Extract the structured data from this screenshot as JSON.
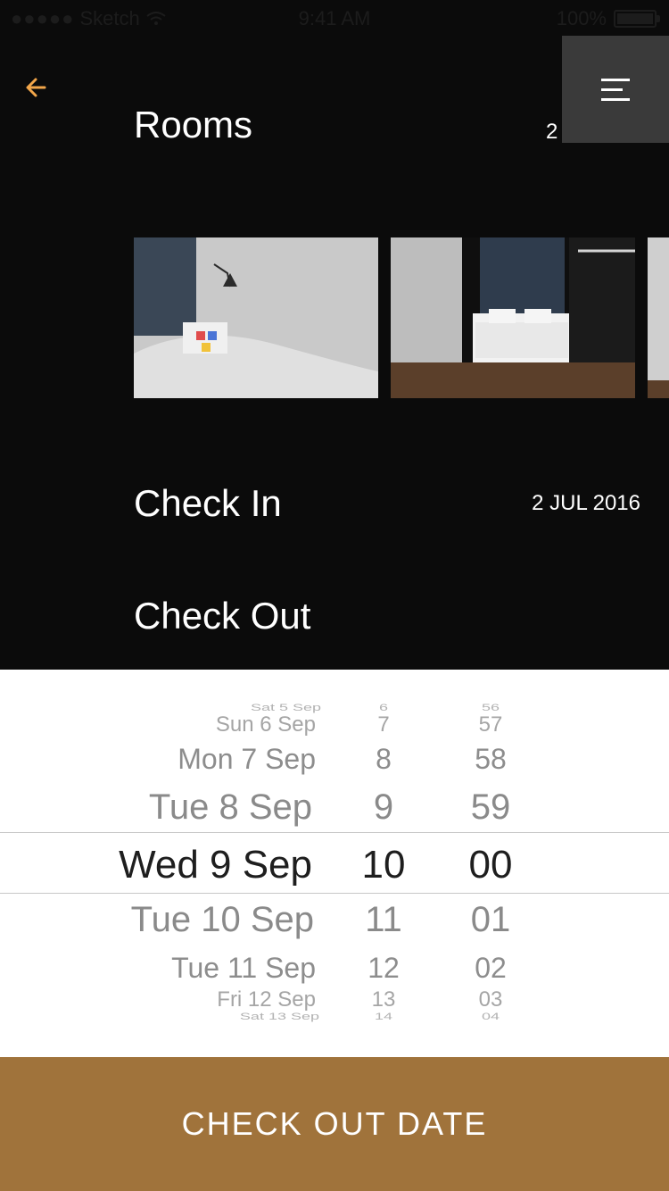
{
  "status_bar": {
    "carrier": "Sketch",
    "time": "9:41 AM",
    "battery": "100%"
  },
  "header": {
    "rooms_title": "Rooms",
    "rooms_count": "2"
  },
  "booking": {
    "check_in_label": "Check In",
    "check_in_date": "2 JUL 2016",
    "check_out_label": "Check Out"
  },
  "picker": {
    "dates": [
      "Sat 5 Sep",
      "Sun 6 Sep",
      "Mon 7 Sep",
      "Tue 8 Sep",
      "Wed 9 Sep",
      "Tue 10 Sep",
      "Tue 11 Sep",
      "Fri 12 Sep",
      "Sat 13 Sep"
    ],
    "hours": [
      "6",
      "7",
      "8",
      "9",
      "10",
      "11",
      "12",
      "13",
      "14"
    ],
    "minutes": [
      "56",
      "57",
      "58",
      "59",
      "00",
      "01",
      "02",
      "03",
      "04"
    ]
  },
  "cta": {
    "label": "CHECK OUT DATE"
  },
  "colors": {
    "accent": "#a0733b",
    "background": "#0b0b0b",
    "menu_bg": "#3a3a3a"
  },
  "icons": {
    "back": "arrow-left-icon",
    "menu": "menu-icon",
    "wifi": "wifi-icon",
    "battery": "battery-icon"
  }
}
